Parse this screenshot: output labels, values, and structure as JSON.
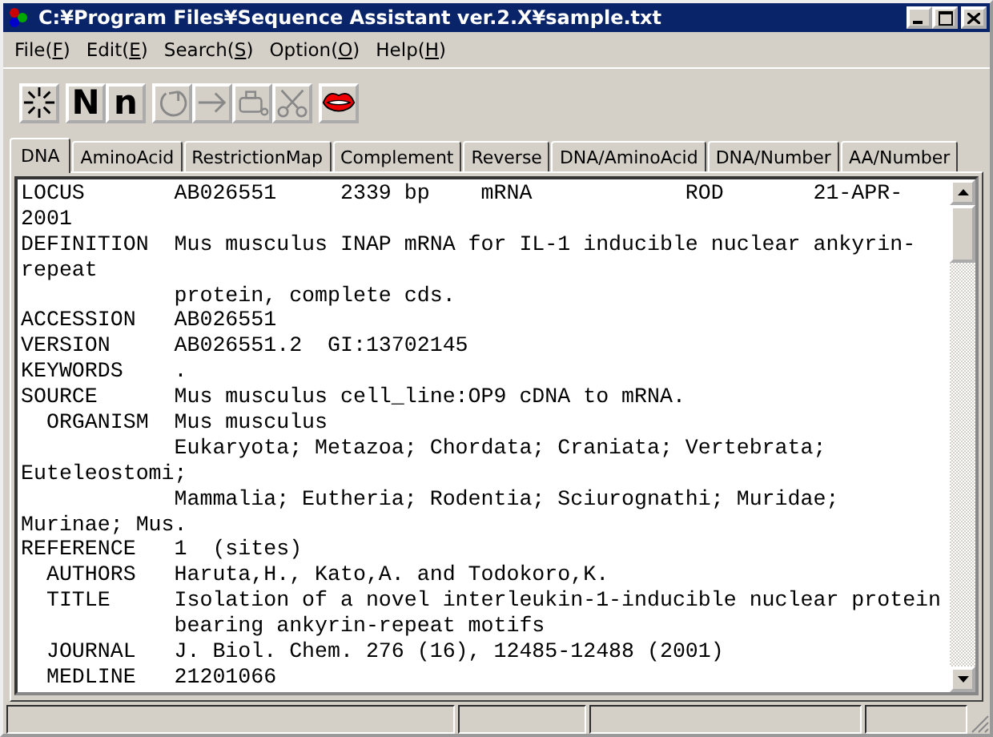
{
  "window": {
    "title": "C:¥Program Files¥Sequence Assistant ver.2.X¥sample.txt"
  },
  "menu": [
    {
      "label": "File(F)"
    },
    {
      "label": "Edit(E)"
    },
    {
      "label": "Search(S)"
    },
    {
      "label": "Option(O)"
    },
    {
      "label": "Help(H)"
    }
  ],
  "toolbar": [
    {
      "kind": "burst",
      "disabled": false
    },
    {
      "kind": "text",
      "text": "N",
      "disabled": false
    },
    {
      "kind": "text",
      "text": "n",
      "disabled": false
    },
    {
      "kind": "rotate",
      "disabled": true
    },
    {
      "kind": "arrow",
      "disabled": true
    },
    {
      "kind": "device",
      "disabled": true
    },
    {
      "kind": "scissors",
      "disabled": true
    },
    {
      "kind": "lips",
      "disabled": false
    }
  ],
  "tabs": [
    {
      "label": "DNA",
      "selected": true
    },
    {
      "label": "AminoAcid",
      "selected": false
    },
    {
      "label": "RestrictionMap",
      "selected": false
    },
    {
      "label": "Complement",
      "selected": false
    },
    {
      "label": "Reverse",
      "selected": false
    },
    {
      "label": "DNA/AminoAcid",
      "selected": false
    },
    {
      "label": "DNA/Number",
      "selected": false
    },
    {
      "label": "AA/Number",
      "selected": false
    }
  ],
  "text_lines": [
    "LOCUS       AB026551     2339 bp    mRNA            ROD       21-APR-",
    "2001",
    "DEFINITION  Mus musculus INAP mRNA for IL-1 inducible nuclear ankyrin-",
    "repeat",
    "            protein, complete cds.",
    "ACCESSION   AB026551",
    "VERSION     AB026551.2  GI:13702145",
    "KEYWORDS    .",
    "SOURCE      Mus musculus cell_line:OP9 cDNA to mRNA.",
    "  ORGANISM  Mus musculus",
    "            Eukaryota; Metazoa; Chordata; Craniata; Vertebrata;",
    "Euteleostomi;",
    "            Mammalia; Eutheria; Rodentia; Sciurognathi; Muridae;",
    "Murinae; Mus.",
    "REFERENCE   1  (sites)",
    "  AUTHORS   Haruta,H., Kato,A. and Todokoro,K.",
    "  TITLE     Isolation of a novel interleukin-1-inducible nuclear protein",
    "            bearing ankyrin-repeat motifs",
    "  JOURNAL   J. Biol. Chem. 276 (16), 12485-12488 (2001)",
    "  MEDLINE   21201066"
  ]
}
